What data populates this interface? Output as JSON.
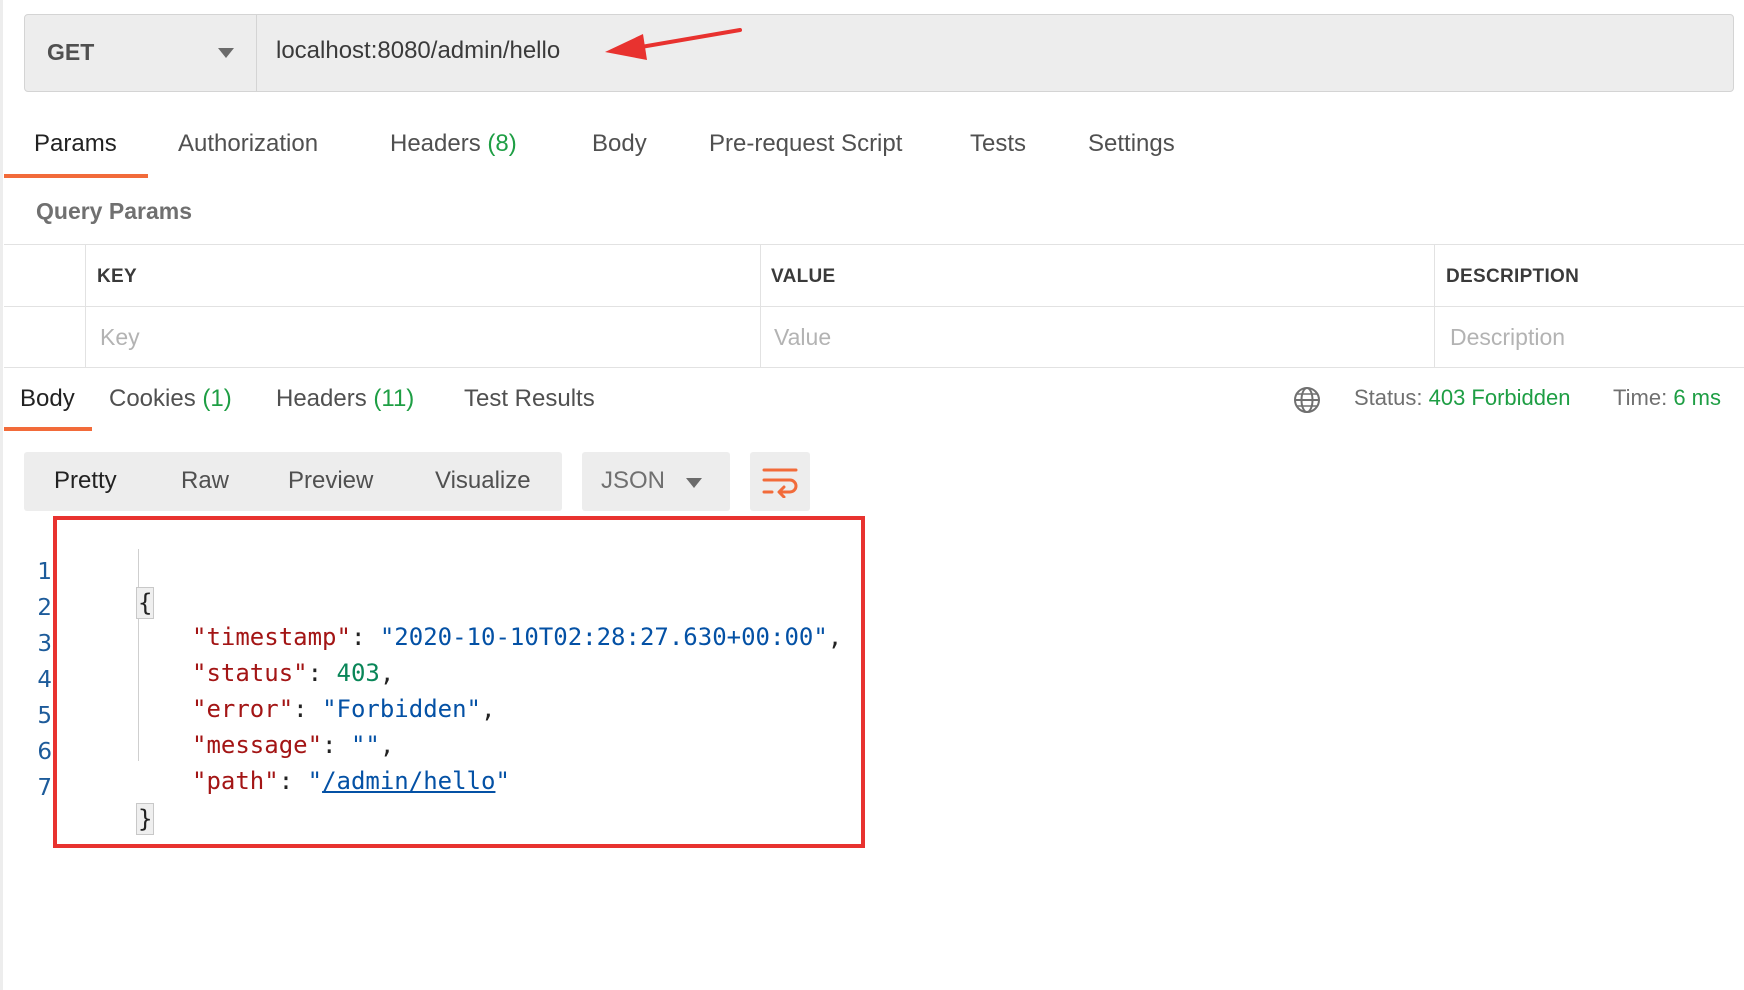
{
  "request": {
    "method": "GET",
    "url": "localhost:8080/admin/hello"
  },
  "request_tabs": [
    {
      "label": "Params",
      "count": ""
    },
    {
      "label": "Authorization",
      "count": ""
    },
    {
      "label": "Headers",
      "count": "(8)"
    },
    {
      "label": "Body",
      "count": ""
    },
    {
      "label": "Pre-request Script",
      "count": ""
    },
    {
      "label": "Tests",
      "count": ""
    },
    {
      "label": "Settings",
      "count": ""
    }
  ],
  "query_params": {
    "title": "Query Params",
    "columns": [
      "KEY",
      "VALUE",
      "DESCRIPTION"
    ],
    "placeholders": [
      "Key",
      "Value",
      "Description"
    ]
  },
  "response_tabs": [
    {
      "label": "Body",
      "count": ""
    },
    {
      "label": "Cookies",
      "count": "(1)"
    },
    {
      "label": "Headers",
      "count": "(11)"
    },
    {
      "label": "Test Results",
      "count": ""
    }
  ],
  "response_status": {
    "status_label": "Status:",
    "status_value": "403 Forbidden",
    "time_label": "Time:",
    "time_value": "6 ms"
  },
  "view_modes": [
    "Pretty",
    "Raw",
    "Preview",
    "Visualize"
  ],
  "format": "JSON",
  "body_lines": [
    {
      "n": "1",
      "open": "{"
    },
    {
      "n": "2",
      "key": "\"timestamp\"",
      "sep": ": ",
      "val": "\"2020-10-10T02:28:27.630+00:00\"",
      "type": "string",
      "end": ","
    },
    {
      "n": "3",
      "key": "\"status\"",
      "sep": ": ",
      "val": "403",
      "type": "number",
      "end": ","
    },
    {
      "n": "4",
      "key": "\"error\"",
      "sep": ": ",
      "val": "\"Forbidden\"",
      "type": "string",
      "end": ","
    },
    {
      "n": "5",
      "key": "\"message\"",
      "sep": ": ",
      "val": "\"\"",
      "type": "string",
      "end": ","
    },
    {
      "n": "6",
      "key": "\"path\"",
      "sep": ": ",
      "q1": "\"",
      "link": "/admin/hello",
      "q2": "\"",
      "type": "link",
      "end": ""
    },
    {
      "n": "7",
      "open": "}"
    }
  ],
  "colors": {
    "accent": "#f26b3a",
    "status_green": "#1e9e44",
    "highlight_box": "#e8322f",
    "json_key": "#a31515",
    "json_string": "#0451a5",
    "json_number": "#098658"
  },
  "icons": {
    "method_dropdown": "chevron-down-icon",
    "annotation": "red-arrow-icon",
    "globe": "globe-icon",
    "format_dropdown": "chevron-down-icon",
    "wrap": "wrap-lines-icon"
  }
}
